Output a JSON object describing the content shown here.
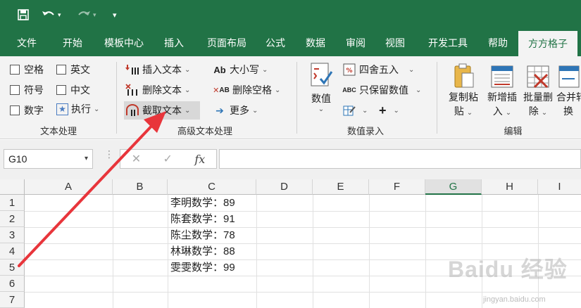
{
  "titlebar": {
    "qa_items": [
      "save-icon",
      "undo-icon",
      "redo-icon",
      "customize-icon"
    ]
  },
  "tabs": [
    "文件",
    "开始",
    "模板中心",
    "插入",
    "页面布局",
    "公式",
    "数据",
    "审阅",
    "视图",
    "开发工具",
    "帮助",
    "方方格子"
  ],
  "active_tab": "方方格子",
  "ribbon": {
    "text_group": {
      "label": "文本处理",
      "checkboxes": [
        "空格",
        "英文",
        "符号",
        "中文",
        "数字"
      ],
      "execute": "执行"
    },
    "advanced_group": {
      "label": "高级文本处理",
      "items": [
        "插入文本",
        "删除文本",
        "截取文本",
        "大小写",
        "删除空格",
        "更多"
      ]
    },
    "number_group": {
      "label": "数值录入",
      "big_button": "数值",
      "items": [
        "四舍五入",
        "只保留数值"
      ],
      "plus": "+"
    },
    "edit_group": {
      "label": "编辑",
      "buttons": [
        {
          "line1": "复制粘",
          "line2": "贴"
        },
        {
          "line1": "新增插",
          "line2": "入"
        },
        {
          "line1": "批量删",
          "line2": "除"
        },
        {
          "line1": "合并转",
          "line2": "换"
        }
      ]
    }
  },
  "formula_bar": {
    "name_box": "G10",
    "fx": "fx",
    "value": ""
  },
  "grid": {
    "columns": [
      "A",
      "B",
      "C",
      "D",
      "E",
      "F",
      "G",
      "H",
      "I"
    ],
    "selected_column": "G",
    "rows": [
      "1",
      "2",
      "3",
      "4",
      "5",
      "6",
      "7"
    ],
    "c_values": [
      "李明数学：89",
      "陈套数学：91",
      "陈尘数学：78",
      "林琳数学：88",
      "雯雯数学：99"
    ]
  },
  "watermark": {
    "brand": "Baidu 经验",
    "url": "jingyan.baidu.com"
  }
}
